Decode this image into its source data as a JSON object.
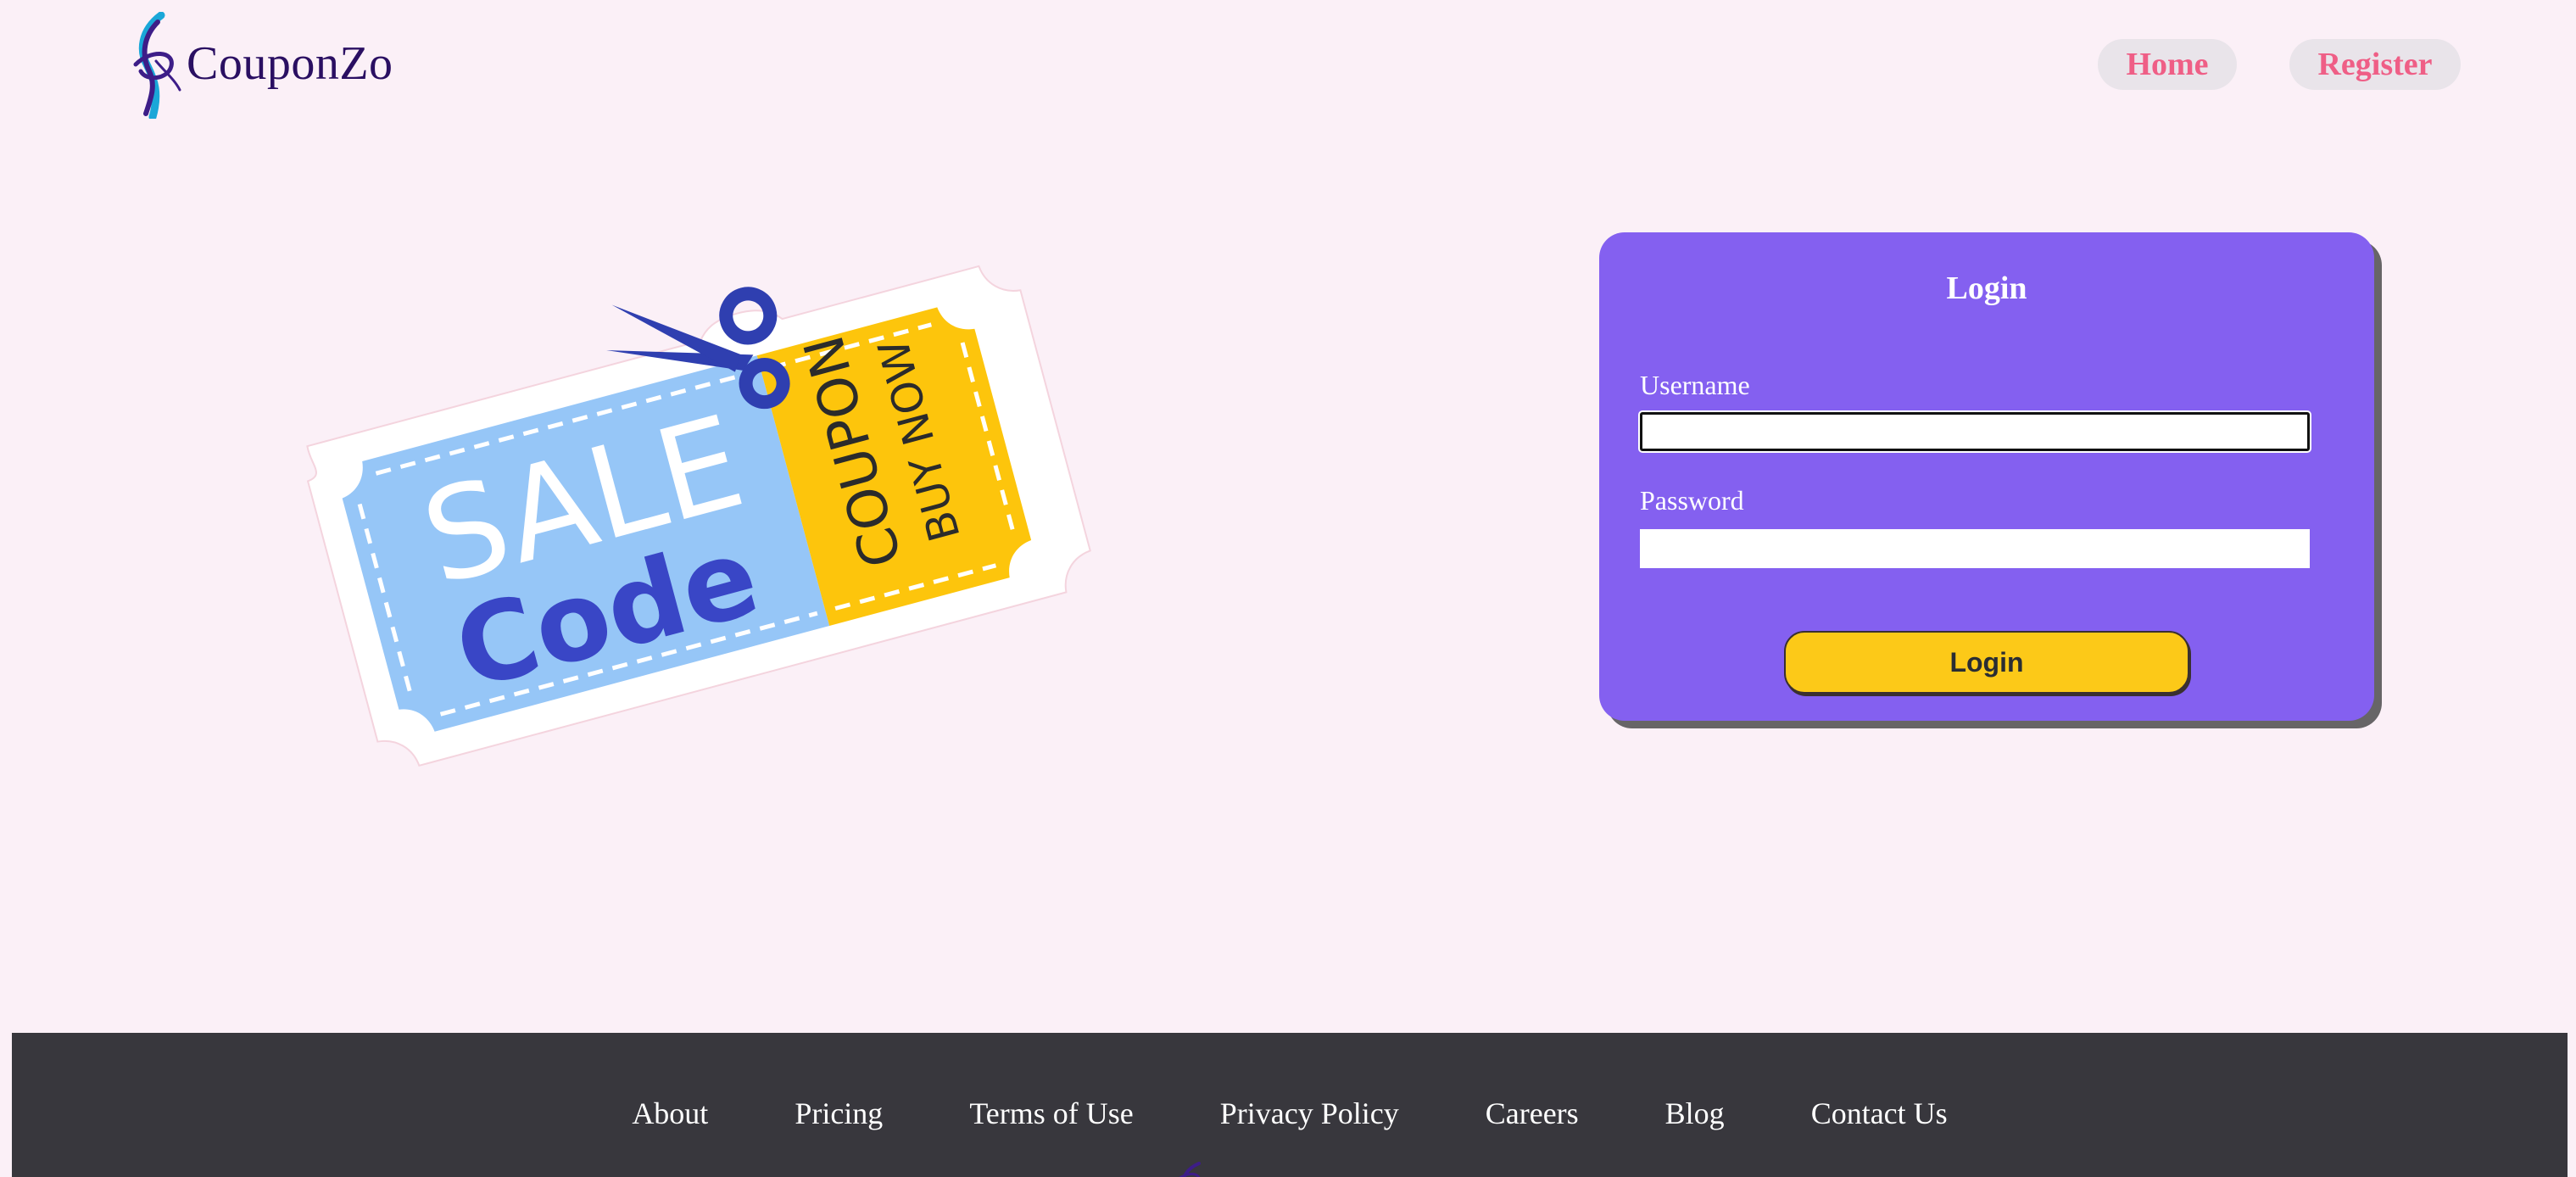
{
  "header": {
    "brand_name": "CouponZo",
    "nav": {
      "home_label": "Home",
      "register_label": "Register"
    }
  },
  "illustration": {
    "icon": "sale-coupon-ticket-illustration",
    "sale_text": "SALE",
    "code_text": "Code",
    "coupon_text": "COUPON",
    "buy_now_text": "BUY NOW"
  },
  "login_form": {
    "title": "Login",
    "username_label": "Username",
    "username_value": "",
    "password_label": "Password",
    "password_value": "",
    "submit_label": "Login"
  },
  "footer": {
    "links": [
      "About",
      "Pricing",
      "Terms of Use",
      "Privacy Policy",
      "Careers",
      "Blog",
      "Contact Us"
    ]
  },
  "colors": {
    "page_background": "#fbf0f7",
    "brand_text": "#2a0f62",
    "nav_text": "#ef5e86",
    "nav_background": "#e9e4ea",
    "card_background": "#8460f0",
    "button_background": "#fcc918",
    "footer_background": "#38373d",
    "coupon_blue": "#96c6f7",
    "coupon_yellow": "#fdc50c",
    "code_text": "#3946c6"
  }
}
